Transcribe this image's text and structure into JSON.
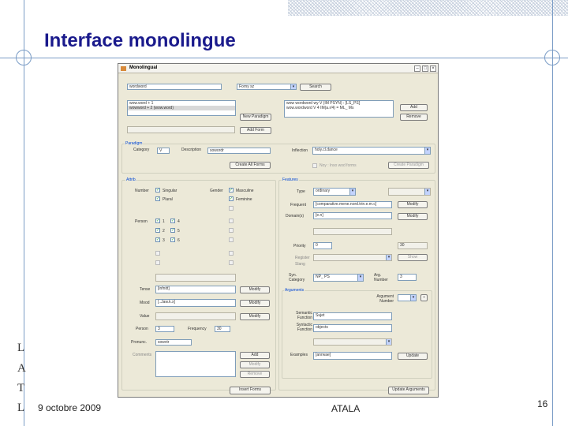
{
  "slide": {
    "title": "Interface monolingue",
    "side_letters": [
      "L",
      "A",
      "T",
      "L"
    ],
    "date": "9 octobre 2009",
    "center": "ATALA",
    "page": "16"
  },
  "window": {
    "title": "Monolingual",
    "top": {
      "search_value": "wordword",
      "combo_value": "Forny sz",
      "search_button": "Search",
      "list_items": [
        "wow.word + 1",
        "wowword + 2 (wow.word)"
      ],
      "list2_items": [
        "wow wordword wy V (IM PSYN) : [LS_PS]",
        "wow.wordword V 4 IM(a.r/4) = ML_ Ms"
      ],
      "add_button": "Add",
      "remove_button": "Remove",
      "new_paradigm_button": "New Paradigm",
      "add_form_button": "Add Form"
    },
    "paradigm": {
      "group": "Paradigm",
      "category_label": "Category",
      "category_value": "V",
      "description_label": "Description",
      "description_value": "sowordr",
      "inflection_label": "Inflection",
      "inflection_value": "holy.cl.dance",
      "create_button": "Create All Forms",
      "check_label": "Noy : lnso wod forms",
      "create_paradigm_button": "Create Paradigm"
    },
    "attributes": {
      "group": "Attrib.",
      "number_label": "Number",
      "singular": "Singular",
      "plural": "Plural",
      "gender_label": "Gender",
      "masculine": "Masculine",
      "feminine": "Feminine",
      "person_label": "Person",
      "p1": "1",
      "p2": "2",
      "p3": "3",
      "p4": "4",
      "p5": "5",
      "p6": "6",
      "tense_label": "Tense",
      "tense_value": "[infnitt]",
      "mood_label": "Mood",
      "mood_value": "[..Jaw.k.x]",
      "value_label": "Value",
      "person2_label": "Person",
      "person2_value": "3",
      "frequency_label": "Frequency",
      "frequency_value": "30",
      "pronunciation_label": "Pronunc.",
      "pronunciation_value": "sowvtr",
      "comments_label": "Comments",
      "modify": "Modify",
      "add": "Add",
      "add_form_footer": "Insert Forms"
    },
    "features": {
      "group": "Features",
      "type_label": "Type",
      "type_value": "ordinary",
      "frequent_label": "Frequent",
      "frequent_value": "[comparative.mene.nord.trin.e.m.c]",
      "domain_label": "Domain(s)",
      "domain_value": "[e.n]",
      "priority_label": "Priority",
      "priority_value": "0",
      "priority2_value": "30",
      "register_label": "Register",
      "register2_label": "Slang",
      "show": "Show",
      "syntax_label": "Syn. Category",
      "syntax_value": "NP_ PS",
      "syntax_num_label": "Arg. Number",
      "syntax_num_value": "3",
      "modify": "Modify",
      "arguments_group": "Arguments",
      "arg_label": "Argument Number",
      "semantic_label": "Semantic Function",
      "semantic_value": "Sujet",
      "syntactic_label": "Syntactic Function",
      "syntactic_value": "objects",
      "examples_label": "Examples",
      "examples_value": "[anrwae]",
      "update_button": "Update",
      "remove_button": "Remove",
      "update_arg_button": "Update Arguments"
    }
  }
}
